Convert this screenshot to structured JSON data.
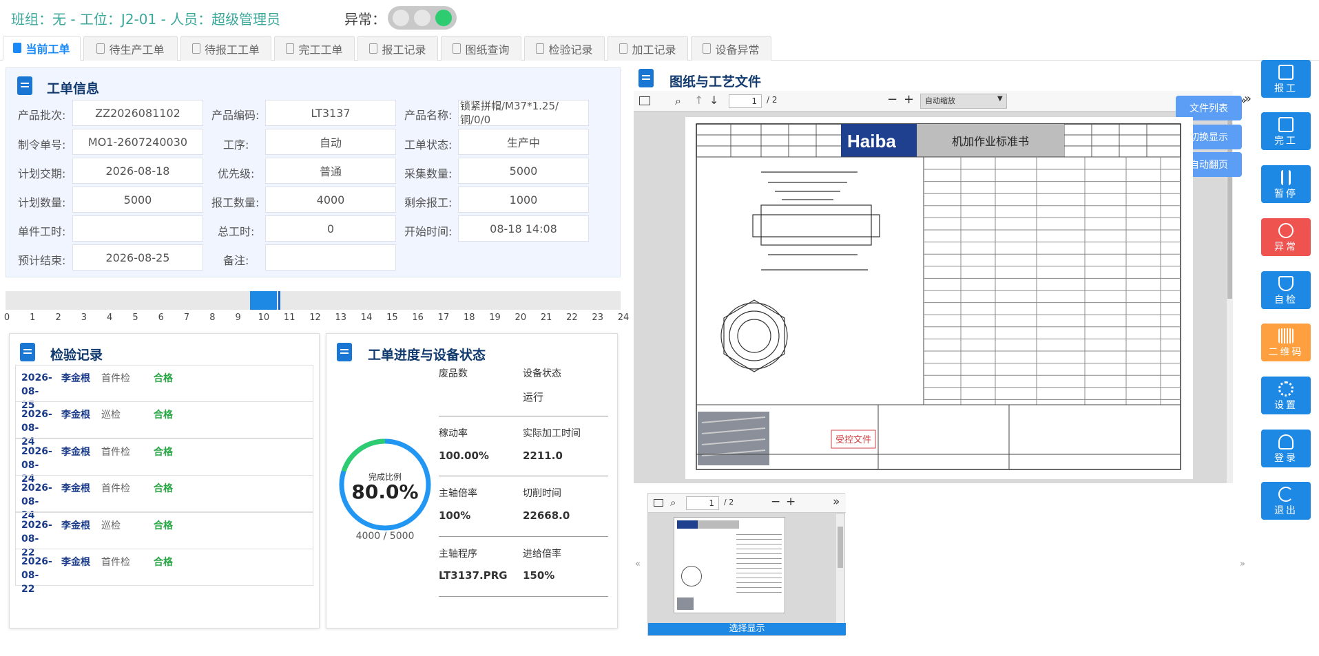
{
  "header": {
    "title": "班组：无 - 工位：J2-01 - 人员：超级管理员",
    "abnormal_label": "异常："
  },
  "tabs": [
    {
      "label": "当前工单",
      "active": true
    },
    {
      "label": "待生产工单"
    },
    {
      "label": "待报工工单"
    },
    {
      "label": "完工工单"
    },
    {
      "label": "报工记录"
    },
    {
      "label": "图纸查询"
    },
    {
      "label": "检验记录"
    },
    {
      "label": "加工记录"
    },
    {
      "label": "设备异常"
    }
  ],
  "work_order": {
    "title": "工单信息",
    "fields": [
      {
        "label": "产品批次:",
        "value": "ZZ2026081102"
      },
      {
        "label": "产品编码:",
        "value": "LT3137"
      },
      {
        "label": "产品名称:",
        "value": "锁紧拼帽/M37*1.25/铜/0/0"
      },
      {
        "label": "制令单号:",
        "value": "MO1-2607240030"
      },
      {
        "label": "工序:",
        "value": "自动"
      },
      {
        "label": "工单状态:",
        "value": "生产中"
      },
      {
        "label": "计划交期:",
        "value": "2026-08-18"
      },
      {
        "label": "优先级:",
        "value": "普通"
      },
      {
        "label": "采集数量:",
        "value": "5000"
      },
      {
        "label": "计划数量:",
        "value": "5000"
      },
      {
        "label": "报工数量:",
        "value": "4000"
      },
      {
        "label": "剩余报工:",
        "value": "1000"
      },
      {
        "label": "单件工时:",
        "value": ""
      },
      {
        "label": "总工时:",
        "value": "0"
      },
      {
        "label": "开始时间:",
        "value": "08-18 14:08"
      },
      {
        "label": "预计结束:",
        "value": "2026-08-25"
      },
      {
        "label": "备注:",
        "value": ""
      }
    ]
  },
  "timeline": {
    "ticks": [
      "0",
      "1",
      "2",
      "3",
      "4",
      "5",
      "6",
      "7",
      "8",
      "9",
      "10",
      "11",
      "12",
      "13",
      "14",
      "15",
      "16",
      "17",
      "18",
      "19",
      "20",
      "21",
      "22",
      "23",
      "24"
    ],
    "current_hour": 10.3
  },
  "inspection": {
    "title": "检验记录",
    "rows": [
      {
        "date": "2026-08-25",
        "name": "李金根",
        "kind": "首件检",
        "result": "合格"
      },
      {
        "date": "2026-08-24",
        "name": "李金根",
        "kind": "巡检",
        "result": "合格"
      },
      {
        "date": "2026-08-24",
        "name": "李金根",
        "kind": "首件检",
        "result": "合格"
      },
      {
        "date": "2026-08-24",
        "name": "李金根",
        "kind": "首件检",
        "result": "合格"
      },
      {
        "date": "2026-08-22",
        "name": "李金根",
        "kind": "巡检",
        "result": "合格"
      },
      {
        "date": "2026-08-22",
        "name": "李金根",
        "kind": "首件检",
        "result": "合格"
      }
    ]
  },
  "progress": {
    "title": "工单进度与设备状态",
    "ring_label": "完成比例",
    "ring_value": "80.0%",
    "ring_fraction": 0.8,
    "ring_count": "4000 / 5000",
    "stats": [
      {
        "label": "废品数",
        "value": ""
      },
      {
        "label": "设备状态",
        "value": "运行"
      },
      {
        "label": "稼动率",
        "value": "100.00%"
      },
      {
        "label": "实际加工时间",
        "value": "2211.0"
      },
      {
        "label": "主轴倍率",
        "value": "100%"
      },
      {
        "label": "切削时间",
        "value": "22668.0"
      },
      {
        "label": "主轴程序",
        "value": "LT3137.PRG"
      },
      {
        "label": "进给倍率",
        "value": "150%"
      }
    ]
  },
  "drawing": {
    "title": "图纸与工艺文件",
    "page_input": "1",
    "page_total": "/ 2",
    "zoom_select": "自动缩放",
    "overlay_buttons": [
      "文件列表",
      "切换显示",
      "自动翻页"
    ],
    "sheet_title": "机加作业标准书",
    "logo": "Haiba",
    "stamp": "受控文件"
  },
  "thumbnail": {
    "page_input": "1",
    "page_total": "/ 2",
    "select_label": "选择显示"
  },
  "side_buttons": [
    {
      "label": "报工",
      "color": "#1e88e5",
      "icon": "report-icon"
    },
    {
      "label": "完工",
      "color": "#1e88e5",
      "icon": "check-icon"
    },
    {
      "label": "暂停",
      "color": "#1e88e5",
      "icon": "pause-icon"
    },
    {
      "label": "异常",
      "color": "#ef5350",
      "icon": "alert-icon"
    },
    {
      "label": "自检",
      "color": "#1e88e5",
      "icon": "shield-check-icon"
    },
    {
      "label": "二维码",
      "color": "#ffa040",
      "icon": "barcode-icon"
    },
    {
      "label": "设置",
      "color": "#1e88e5",
      "icon": "gear-icon"
    },
    {
      "label": "登录",
      "color": "#1e88e5",
      "icon": "user-icon"
    },
    {
      "label": "退出",
      "color": "#1e88e5",
      "icon": "logout-icon"
    }
  ]
}
